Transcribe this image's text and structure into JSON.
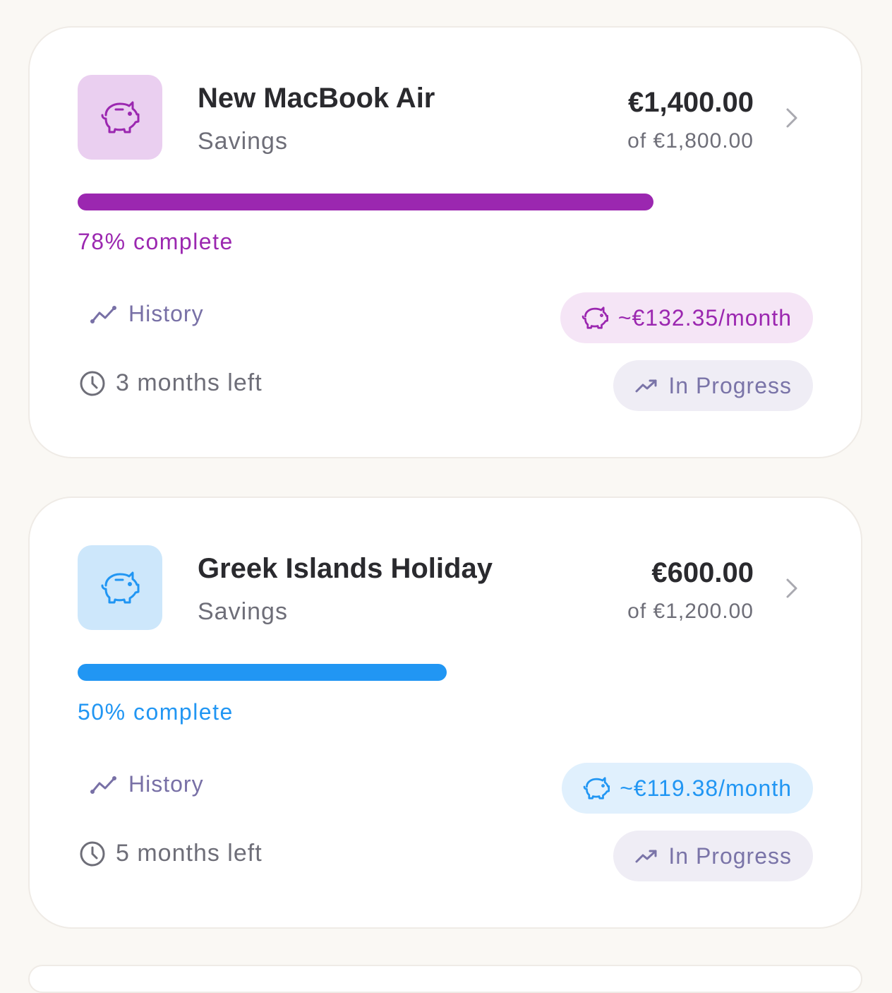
{
  "goals": [
    {
      "name": "New MacBook Air",
      "category": "Savings",
      "saved": "€1,400.00",
      "target": "of €1,800.00",
      "progress_fraction": 0.78,
      "progress_label": "78% complete",
      "history_label": "History",
      "monthly_label": "~€132.35/month",
      "time_left": "3 months left",
      "status": "In Progress",
      "icon": "piggy-bank-icon",
      "accent_color": "#9b27b0",
      "tile_color": "#eacff0",
      "pill_color": "#f5e5f6"
    },
    {
      "name": "Greek Islands Holiday",
      "category": "Savings",
      "saved": "€600.00",
      "target": "of €1,200.00",
      "progress_fraction": 0.5,
      "progress_label": "50% complete",
      "history_label": "History",
      "monthly_label": "~€119.38/month",
      "time_left": "5 months left",
      "status": "In Progress",
      "icon": "piggy-bank-icon",
      "accent_color": "#2196f3",
      "tile_color": "#cde7fb",
      "pill_color": "#e0f0fd"
    }
  ]
}
